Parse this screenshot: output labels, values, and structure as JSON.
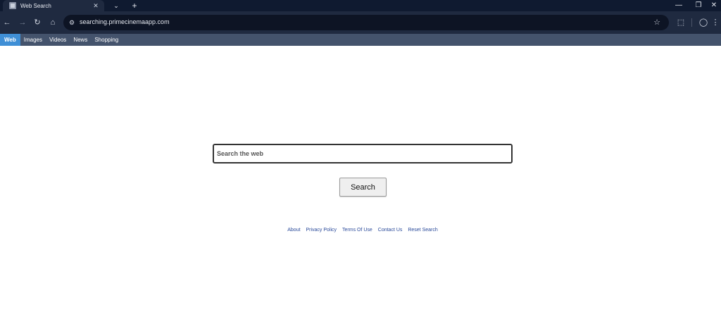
{
  "browser": {
    "tab": {
      "title": "Web Search",
      "favicon": "page-icon"
    },
    "tab_dropdown_icon": "⌄",
    "new_tab_icon": "+",
    "window_controls": {
      "minimize": "—",
      "maximize": "❐",
      "close": "✕"
    },
    "toolbar": {
      "back_icon": "←",
      "forward_icon": "→",
      "reload_icon": "↻",
      "home_icon": "⌂",
      "site_info_icon": "⚙",
      "url": "searching.primecinemaapp.com",
      "bookmark_icon": "☆",
      "extensions_icon": "⬚",
      "profile_icon": "◯",
      "menu_icon": "⋮"
    }
  },
  "page_nav": {
    "items": [
      {
        "label": "Web",
        "active": true
      },
      {
        "label": "Images"
      },
      {
        "label": "Videos"
      },
      {
        "label": "News"
      },
      {
        "label": "Shopping"
      }
    ]
  },
  "search": {
    "placeholder": "Search the web",
    "button_label": "Search"
  },
  "footer": {
    "links": [
      "About",
      "Privacy Policy",
      "Terms Of Use",
      "Contact Us",
      "Reset Search"
    ]
  },
  "colors": {
    "titlebar": "#0f1a30",
    "toolbar": "#1f2a40",
    "page_nav": "#44536c",
    "active_nav": "#3f8fd6",
    "footer_link": "#2a4a9a"
  }
}
